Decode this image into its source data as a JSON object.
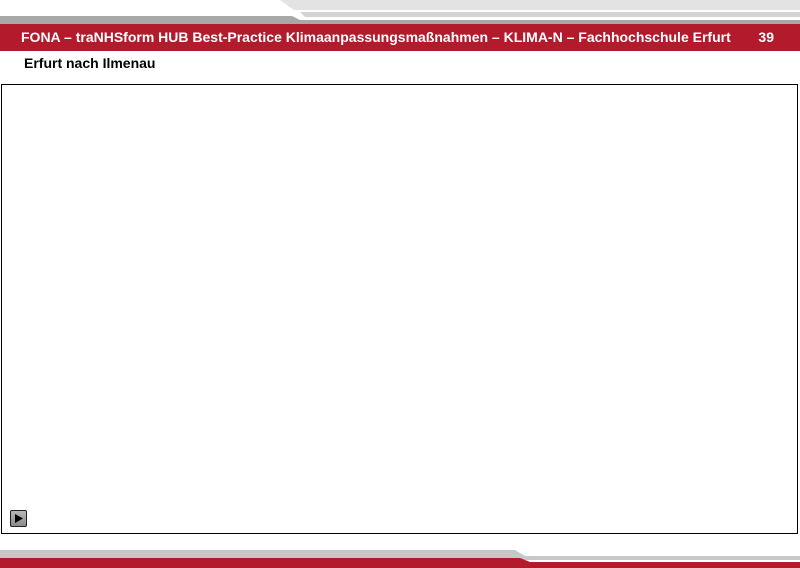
{
  "header": {
    "title": "FONA – traNHSform HUB Best-Practice Klimaanpassungsmaßnahmen – KLIMA-N – Fachhochschule Erfurt",
    "page_number": "39"
  },
  "slide": {
    "subtitle": "Erfurt nach Ilmenau"
  },
  "colors": {
    "accent": "#b31b2d",
    "stripe_gray": "#c8c8c8"
  },
  "media": {
    "control_icon": "play-icon"
  }
}
